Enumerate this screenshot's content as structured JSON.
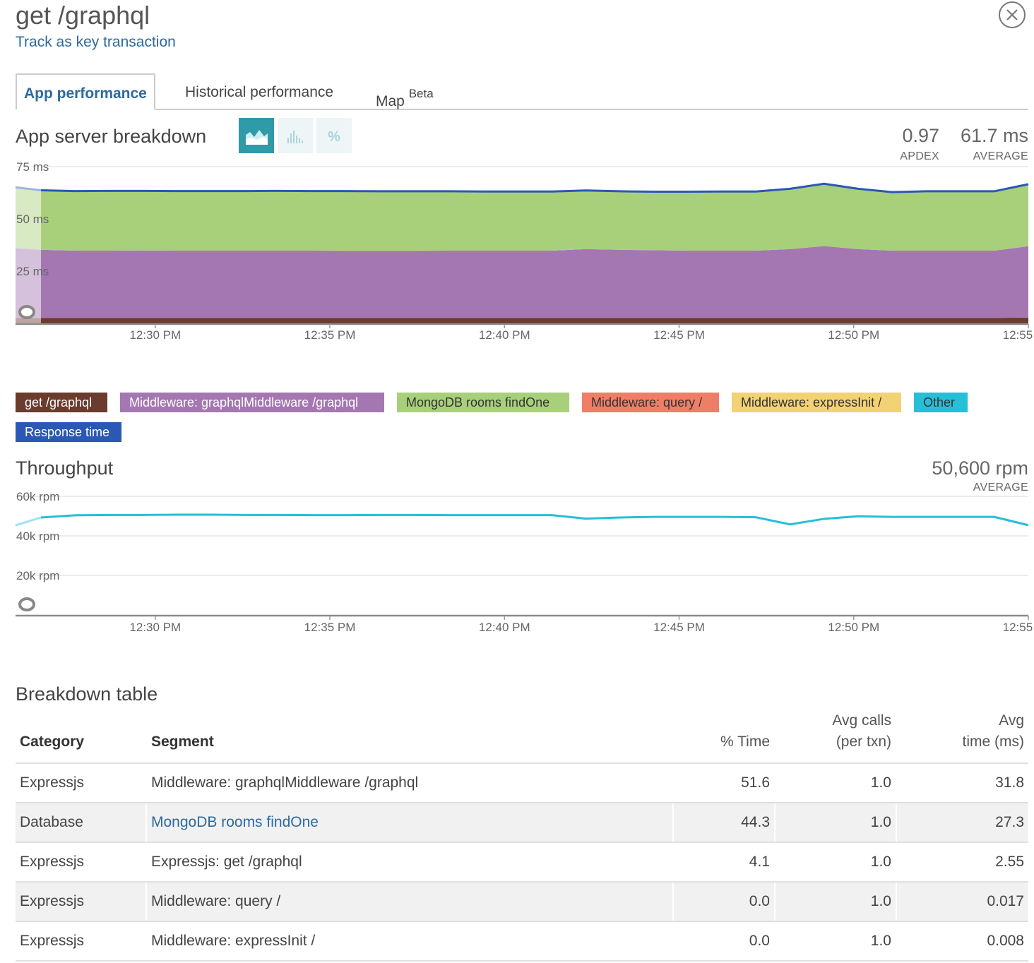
{
  "header": {
    "title": "get /graphql",
    "track_link": "Track as key transaction"
  },
  "tabs": [
    {
      "label": "App performance",
      "sup": ""
    },
    {
      "label": "Historical performance",
      "sup": ""
    },
    {
      "label": "Map",
      "sup": "Beta"
    }
  ],
  "breakdown": {
    "title": "App server breakdown",
    "view_buttons": [
      "area-chart-icon",
      "bar-chart-icon",
      "percent-icon"
    ],
    "apdex_value": "0.97",
    "apdex_label": "APDEX",
    "average_value": "61.7 ms",
    "average_label": "AVERAGE"
  },
  "legend": [
    {
      "label": "get /graphql",
      "color": "#6b3b2e",
      "text_color": "#ffffff"
    },
    {
      "label": "Middleware: graphqlMiddleware /graphql",
      "color": "#a577b2",
      "text_color": "#ffffff"
    },
    {
      "label": "MongoDB rooms findOne",
      "color": "#a8d07a",
      "text_color": "#333333"
    },
    {
      "label": "Middleware: query /",
      "color": "#ee7e66",
      "text_color": "#333333"
    },
    {
      "label": "Middleware: expressInit /",
      "color": "#f2d273",
      "text_color": "#333333"
    },
    {
      "label": "Other",
      "color": "#26bfd6",
      "text_color": "#333333"
    },
    {
      "label": "Response time",
      "color": "#2b58b5",
      "text_color": "#ffffff"
    }
  ],
  "throughput": {
    "title": "Throughput",
    "average_value": "50,600 rpm",
    "average_label": "AVERAGE"
  },
  "chart_data": [
    {
      "type": "area",
      "x": [
        "12:26",
        "12:27",
        "12:28",
        "12:29",
        "12:30",
        "12:31",
        "12:32",
        "12:33",
        "12:34",
        "12:35",
        "12:36",
        "12:37",
        "12:38",
        "12:39",
        "12:40",
        "12:41",
        "12:42",
        "12:43",
        "12:44",
        "12:45",
        "12:46",
        "12:47",
        "12:48",
        "12:49",
        "12:50",
        "12:51",
        "12:52",
        "12:53",
        "12:54",
        "12:55",
        "12:56"
      ],
      "xticks": [
        "12:30 PM",
        "12:35 PM",
        "12:40 PM",
        "12:45 PM",
        "12:50 PM",
        "12:55 PM"
      ],
      "yticks": [
        "75 ms",
        "50 ms",
        "25 ms"
      ],
      "ylim": [
        0,
        75
      ],
      "series": [
        {
          "name": "get /graphql",
          "color": "#6b3b2e",
          "values": [
            2.6,
            2.6,
            2.6,
            2.6,
            2.6,
            2.6,
            2.6,
            2.6,
            2.6,
            2.6,
            2.6,
            2.6,
            2.6,
            2.6,
            2.6,
            2.6,
            2.6,
            2.6,
            2.6,
            2.6,
            2.6,
            2.6,
            2.6,
            2.6,
            2.6,
            2.6,
            2.6,
            2.6,
            2.6,
            2.6,
            2.8
          ]
        },
        {
          "name": "Middleware: graphqlMiddleware /graphql",
          "color": "#a577b2",
          "values": [
            33.4,
            32.6,
            32.2,
            32.2,
            32.3,
            32.2,
            32.2,
            32.2,
            32.2,
            32.2,
            32.1,
            32.1,
            32.1,
            32.2,
            32.2,
            32.2,
            32.2,
            32.9,
            32.6,
            32.4,
            32.2,
            32.2,
            32.2,
            32.9,
            34.4,
            32.9,
            32.2,
            32.2,
            32.2,
            32.2,
            34.1
          ]
        },
        {
          "name": "MongoDB rooms findOne",
          "color": "#a8d07a",
          "values": [
            29.1,
            28.5,
            28.5,
            28.6,
            28.5,
            28.5,
            28.5,
            28.5,
            28.6,
            28.5,
            28.6,
            28.5,
            28.5,
            28.4,
            28.3,
            28.3,
            28.3,
            28.1,
            28.0,
            28.0,
            28.2,
            28.3,
            28.3,
            28.9,
            29.8,
            28.9,
            28.0,
            28.4,
            28.4,
            28.4,
            29.7
          ]
        }
      ],
      "response_time": {
        "name": "Response time",
        "color": "#2b58b5",
        "values": [
          65.1,
          63.7,
          63.3,
          63.4,
          63.4,
          63.3,
          63.3,
          63.3,
          63.4,
          63.3,
          63.3,
          63.2,
          63.2,
          63.2,
          63.1,
          63.1,
          63.1,
          63.6,
          63.2,
          63.0,
          63.0,
          63.1,
          63.1,
          64.4,
          66.8,
          64.4,
          62.8,
          63.2,
          63.2,
          63.2,
          66.6
        ]
      }
    },
    {
      "type": "line",
      "x": [
        "12:26",
        "12:27",
        "12:28",
        "12:29",
        "12:30",
        "12:31",
        "12:32",
        "12:33",
        "12:34",
        "12:35",
        "12:36",
        "12:37",
        "12:38",
        "12:39",
        "12:40",
        "12:41",
        "12:42",
        "12:43",
        "12:44",
        "12:45",
        "12:46",
        "12:47",
        "12:48",
        "12:49",
        "12:50",
        "12:51",
        "12:52",
        "12:53",
        "12:54",
        "12:55",
        "12:56"
      ],
      "xticks": [
        "12:30 PM",
        "12:35 PM",
        "12:40 PM",
        "12:45 PM",
        "12:50 PM",
        "12:55 PM"
      ],
      "yticks": [
        "60k rpm",
        "40k rpm",
        "20k rpm"
      ],
      "ylim": [
        0,
        60000
      ],
      "series": [
        {
          "name": "Other",
          "color": "#26bfd6",
          "values": [
            45400,
            49300,
            50400,
            50600,
            50600,
            50700,
            50700,
            50600,
            50600,
            50500,
            50500,
            50600,
            50600,
            50500,
            50500,
            50500,
            50500,
            48700,
            49300,
            49600,
            49600,
            49600,
            49400,
            45800,
            48600,
            49900,
            49600,
            49600,
            49600,
            49600,
            45400
          ]
        }
      ]
    }
  ],
  "table": {
    "title": "Breakdown table",
    "columns": [
      {
        "line1": "",
        "line2": "Category"
      },
      {
        "line1": "",
        "line2": "Segment"
      },
      {
        "line1": "",
        "line2": "% Time"
      },
      {
        "line1": "Avg calls",
        "line2": "(per txn)"
      },
      {
        "line1": "Avg",
        "line2": "time (ms)"
      }
    ],
    "rows": [
      {
        "category": "Expressjs",
        "segment": "Middleware: graphqlMiddleware /graphql",
        "pct": "51.6",
        "calls": "1.0",
        "avg": "31.8",
        "link": false
      },
      {
        "category": "Database",
        "segment": "MongoDB rooms findOne",
        "pct": "44.3",
        "calls": "1.0",
        "avg": "27.3",
        "link": true
      },
      {
        "category": "Expressjs",
        "segment": "Expressjs: get /graphql",
        "pct": "4.1",
        "calls": "1.0",
        "avg": "2.55",
        "link": false
      },
      {
        "category": "Expressjs",
        "segment": "Middleware: query /",
        "pct": "0.0",
        "calls": "1.0",
        "avg": "0.017",
        "link": false
      },
      {
        "category": "Expressjs",
        "segment": "Middleware: expressInit /",
        "pct": "0.0",
        "calls": "1.0",
        "avg": "0.008",
        "link": false
      }
    ]
  }
}
